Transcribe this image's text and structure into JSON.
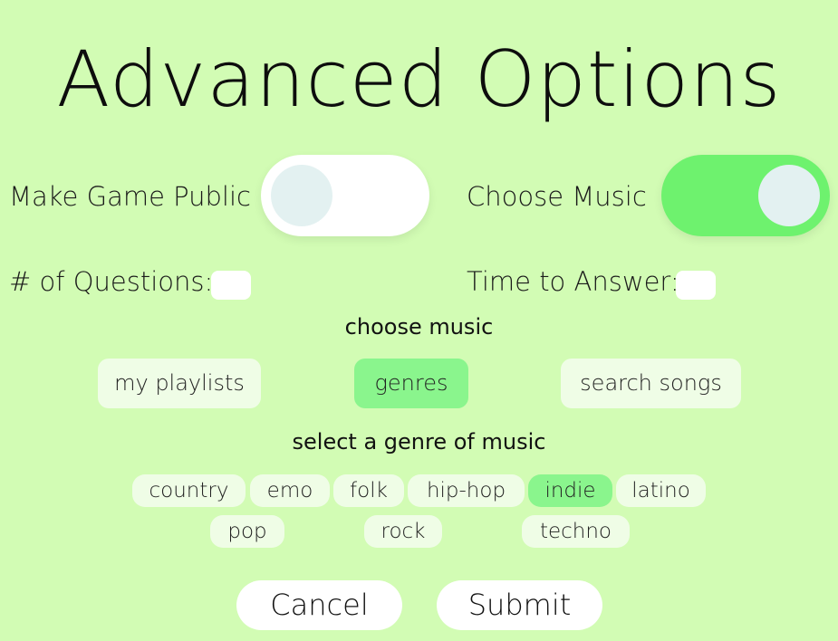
{
  "title": "Advanced Options",
  "toggles": {
    "public": {
      "label": "Make Game Public",
      "on": false
    },
    "music": {
      "label": "Choose Music",
      "on": true
    }
  },
  "fields": {
    "questions": {
      "label": "# of Questions:",
      "value": ""
    },
    "time": {
      "label": "Time to Answer:",
      "value": ""
    }
  },
  "music_heading": "choose music",
  "tabs": [
    {
      "label": "my playlists",
      "selected": false
    },
    {
      "label": "genres",
      "selected": true
    },
    {
      "label": "search songs",
      "selected": false
    }
  ],
  "genre_heading": "select a genre of music",
  "genres": [
    {
      "label": "country",
      "selected": false
    },
    {
      "label": "emo",
      "selected": false
    },
    {
      "label": "folk",
      "selected": false
    },
    {
      "label": "hip-hop",
      "selected": false
    },
    {
      "label": "indie",
      "selected": true
    },
    {
      "label": "latino",
      "selected": false
    },
    {
      "label": "pop",
      "selected": false
    },
    {
      "label": "rock",
      "selected": false
    },
    {
      "label": "techno",
      "selected": false
    }
  ],
  "buttons": {
    "cancel": "Cancel",
    "submit": "Submit"
  },
  "colors": {
    "background": "#d2fcb4",
    "accent": "#6ef26e",
    "selected": "#8af58d",
    "chip": "#effde6"
  }
}
